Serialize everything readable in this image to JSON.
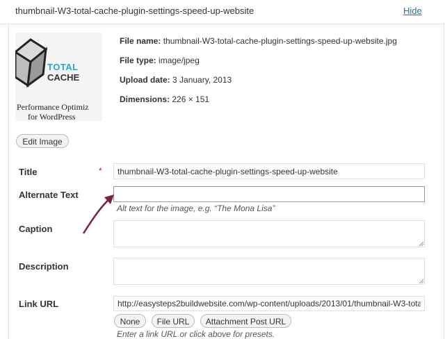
{
  "header": {
    "title": "thumbnail-W3-total-cache-plugin-settings-speed-up-website",
    "hide_label": "Hide"
  },
  "thumbnail": {
    "line1": "TOTAL",
    "line2": "CACHE",
    "line3": "Performance Optimiz",
    "line4": "for WordPress"
  },
  "file_info": {
    "file_name_label": "File name:",
    "file_name_value": "thumbnail-W3-total-cache-plugin-settings-speed-up-website.jpg",
    "file_type_label": "File type:",
    "file_type_value": "image/jpeg",
    "upload_date_label": "Upload date:",
    "upload_date_value": "3 January, 2013",
    "dimensions_label": "Dimensions:",
    "dimensions_value": "226 × 151"
  },
  "edit_image_label": "Edit Image",
  "fields": {
    "title_label": "Title",
    "required_mark": "*",
    "title_value": "thumbnail-W3-total-cache-plugin-settings-speed-up-website",
    "alt_label": "Alternate Text",
    "alt_value": "",
    "alt_help": "Alt text for the image, e.g. “The Mona Lisa”",
    "caption_label": "Caption",
    "caption_value": "",
    "description_label": "Description",
    "description_value": "",
    "link_label": "Link URL",
    "link_value": "http://easysteps2buildwebsite.com/wp-content/uploads/2013/01/thumbnail-W3-tota",
    "link_help": "Enter a link URL or click above for presets."
  },
  "link_buttons": {
    "none": "None",
    "file_url": "File URL",
    "attachment_post_url": "Attachment Post URL"
  },
  "colors": {
    "link": "#21759b",
    "arrow": "#7a1f4a",
    "required": "#ff0000"
  }
}
